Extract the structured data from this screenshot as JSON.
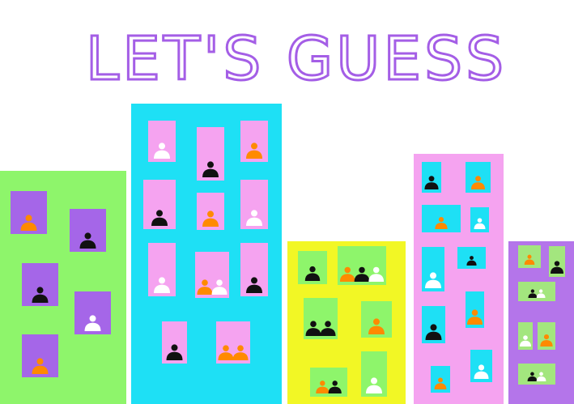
{
  "title": "LET'S GUESS",
  "colors": {
    "title": "#a45ee6",
    "window_light_green": "#a3e67e",
    "pawn_orange": "#ff8a00",
    "pawn_black": "#111111",
    "pawn_white": "#ffffff"
  },
  "buildings": [
    {
      "name": "green-building",
      "color": "#8ef56b",
      "window_color": "#a566e8",
      "windows": [
        {
          "pawns": [
            "orange"
          ]
        },
        {
          "pawns": [
            "black"
          ]
        },
        {
          "pawns": [
            "black"
          ]
        },
        {
          "pawns": [
            "white"
          ]
        },
        {
          "pawns": [
            "orange"
          ]
        }
      ]
    },
    {
      "name": "cyan-building",
      "color": "#1ee0f5",
      "window_color": "#f5a3f0",
      "windows": [
        {
          "pawns": [
            "white"
          ]
        },
        {
          "pawns": [
            "black"
          ]
        },
        {
          "pawns": [
            "orange"
          ]
        },
        {
          "pawns": [
            "black"
          ]
        },
        {
          "pawns": [
            "orange"
          ]
        },
        {
          "pawns": [
            "white"
          ]
        },
        {
          "pawns": [
            "white"
          ]
        },
        {
          "pawns": [
            "orange",
            "white"
          ]
        },
        {
          "pawns": [
            "black"
          ]
        },
        {
          "pawns": [
            "black"
          ]
        },
        {
          "pawns": [
            "orange",
            "orange"
          ]
        }
      ]
    },
    {
      "name": "yellow-building",
      "color": "#f2f725",
      "window_color": "#8ef56b",
      "windows": [
        {
          "pawns": [
            "black"
          ]
        },
        {
          "pawns": [
            "orange",
            "black",
            "white"
          ]
        },
        {
          "pawns": [
            "black",
            "black"
          ]
        },
        {
          "pawns": [
            "orange"
          ]
        },
        {
          "pawns": [
            "orange",
            "black"
          ]
        },
        {
          "pawns": [
            "white"
          ]
        }
      ]
    },
    {
      "name": "pink-building",
      "color": "#f5a3f0",
      "window_color": "#1ee0f5",
      "windows": [
        {
          "pawns": [
            "black"
          ]
        },
        {
          "pawns": [
            "orange"
          ]
        },
        {
          "pawns": [
            "orange"
          ]
        },
        {
          "pawns": [
            "white"
          ]
        },
        {
          "pawns": [
            "white"
          ]
        },
        {
          "pawns": [
            "black"
          ]
        },
        {
          "pawns": [
            "orange"
          ]
        },
        {
          "pawns": [
            "black"
          ]
        },
        {
          "pawns": [
            "white"
          ]
        },
        {
          "pawns": [
            "orange"
          ]
        }
      ]
    },
    {
      "name": "purple-building",
      "color": "#b475ea",
      "window_color": "#a3e67e",
      "windows": [
        {
          "pawns": [
            "orange"
          ]
        },
        {
          "pawns": [
            "black"
          ]
        },
        {
          "pawns": [
            "black",
            "white"
          ]
        },
        {
          "pawns": [
            "white"
          ]
        },
        {
          "pawns": [
            "orange"
          ]
        },
        {
          "pawns": [
            "black",
            "white"
          ]
        }
      ]
    }
  ]
}
